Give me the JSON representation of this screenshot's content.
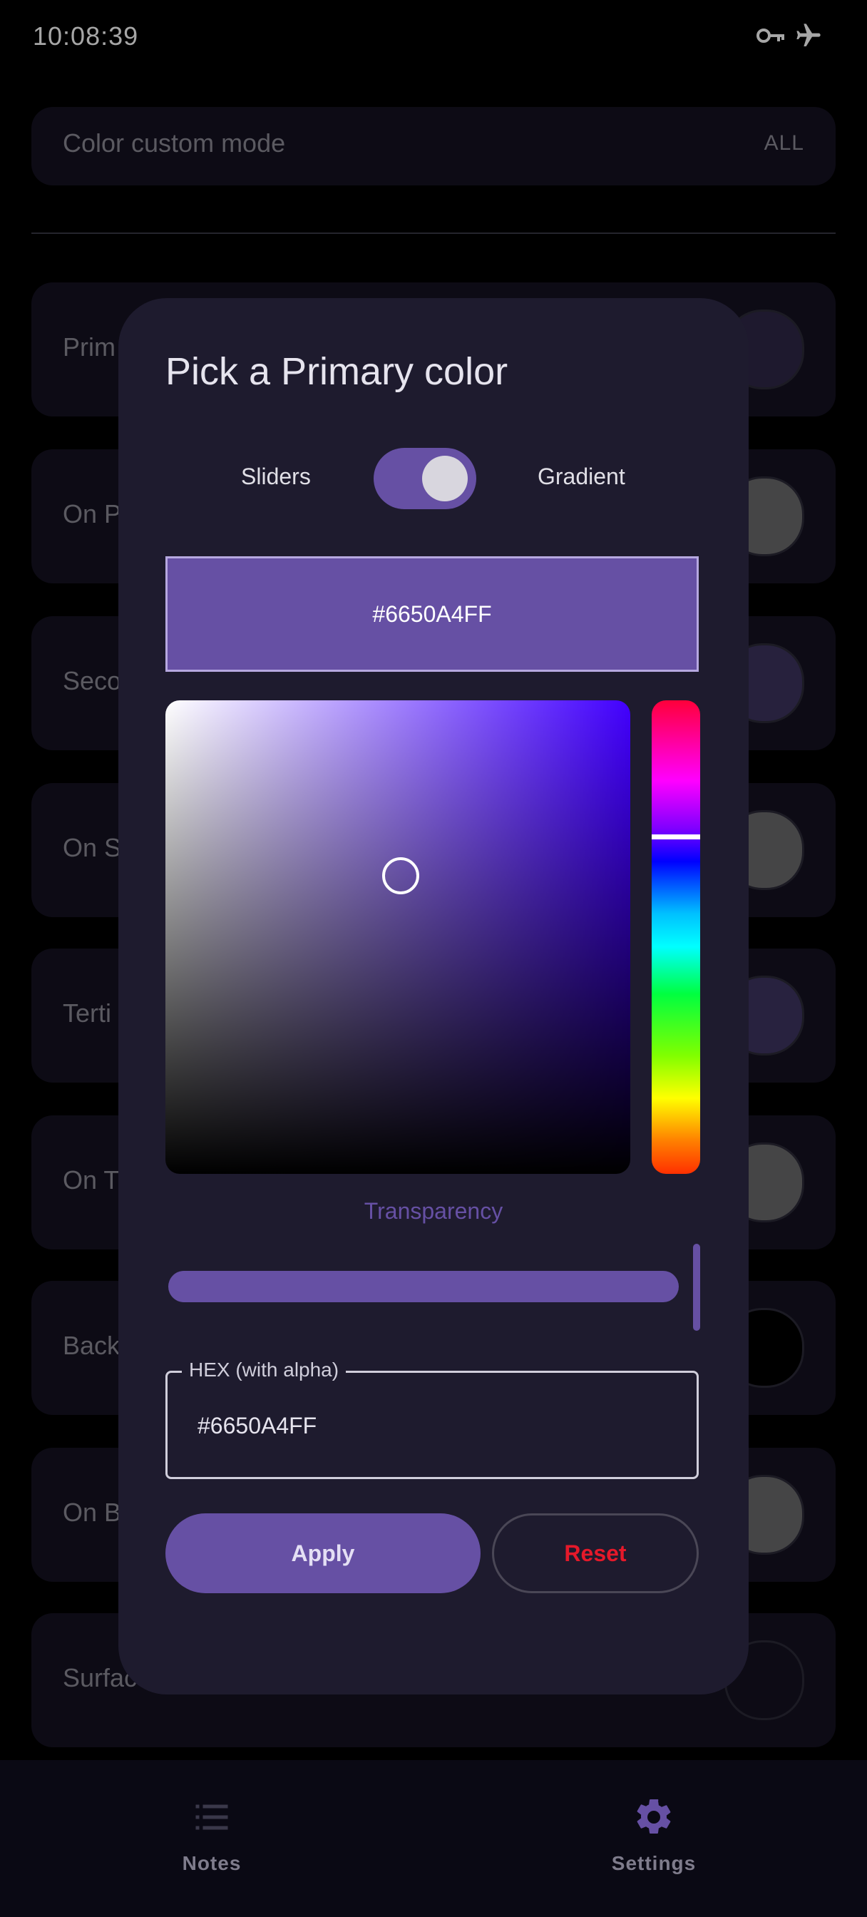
{
  "status_bar": {
    "time": "10:08:39",
    "icons": [
      "vpn-key-icon",
      "airplane-mode-icon"
    ]
  },
  "settings": {
    "color_custom_mode": {
      "label": "Color custom mode",
      "value": "ALL"
    },
    "color_rows": [
      {
        "label": "Prim"
      },
      {
        "label": "On P"
      },
      {
        "label": "Seco"
      },
      {
        "label": "On S"
      },
      {
        "label": "Terti"
      },
      {
        "label": "On T"
      },
      {
        "label": "Back"
      },
      {
        "label": "On B"
      },
      {
        "label": "Surfac"
      }
    ]
  },
  "dialog": {
    "title": "Pick a Primary color",
    "mode_left": "Sliders",
    "mode_right": "Gradient",
    "mode_toggle_on": true,
    "preview_hex": "#6650A4FF",
    "transparency_label": "Transparency",
    "alpha": 1.0,
    "hex_field_label": "HEX (with alpha)",
    "hex_field_value": "#6650A4FF",
    "apply_label": "Apply",
    "reset_label": "Reset"
  },
  "bottom_nav": {
    "items": [
      {
        "label": "Notes",
        "icon": "list-icon",
        "selected": false
      },
      {
        "label": "Settings",
        "icon": "gear-icon",
        "selected": true
      }
    ]
  },
  "colors": {
    "accent": "#6650A4",
    "reset_red": "#E5192A",
    "dialog_bg": "#1E1B2E"
  }
}
